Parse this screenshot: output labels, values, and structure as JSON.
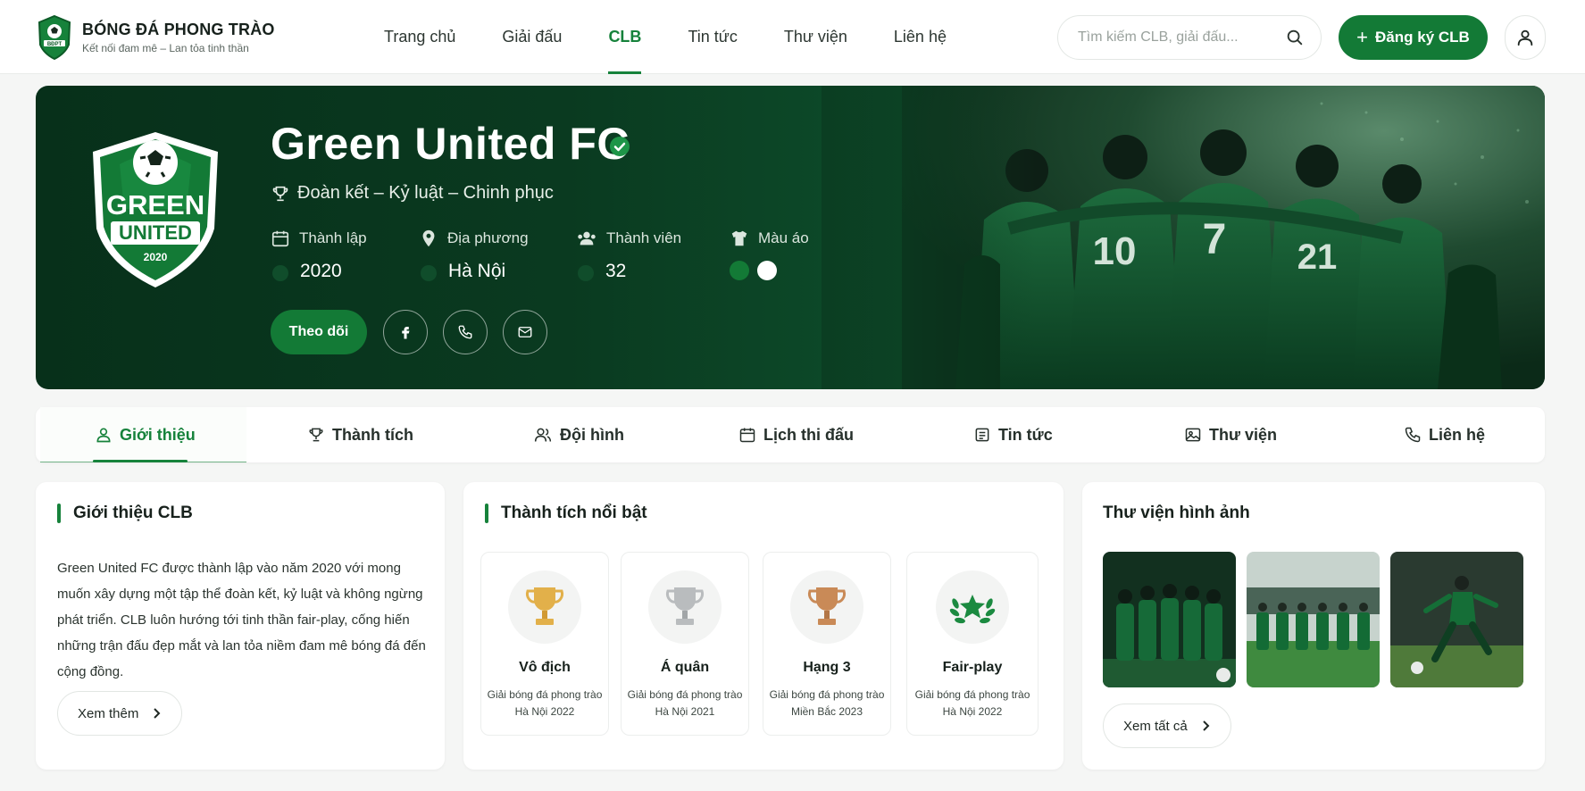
{
  "brand": {
    "title": "BÓNG ĐÁ PHONG TRÀO",
    "subtitle": "Kết nối đam mê – Lan tỏa tinh thần",
    "logo_text": "BĐPT"
  },
  "nav": {
    "items": [
      "Trang chủ",
      "Giải đấu",
      "CLB",
      "Tin tức",
      "Thư viện",
      "Liên hệ"
    ],
    "active": "CLB"
  },
  "search": {
    "placeholder": "Tìm kiếm CLB, giải đấu..."
  },
  "register_button": "Đăng ký CLB",
  "club": {
    "name": "Green United FC",
    "slogan": "Đoàn kết – Kỷ luật – Chinh phục",
    "crest_line1": "GREEN",
    "crest_line2": "UNITED",
    "crest_year": "2020",
    "stats": {
      "founded_label": "Thành lập",
      "founded_value": "2020",
      "location_label": "Địa phương",
      "location_value": "Hà Nội",
      "members_label": "Thành viên",
      "members_value": "32",
      "kit_label": "Màu áo",
      "kit_colors": [
        "#137a36",
        "#ffffff"
      ]
    },
    "follow_button": "Theo dõi"
  },
  "tabs": {
    "items": [
      "Giới thiệu",
      "Thành tích",
      "Đội hình",
      "Lịch thi đấu",
      "Tin tức",
      "Thư viện",
      "Liên hệ"
    ],
    "active": "Giới thiệu"
  },
  "about": {
    "title": "Giới thiệu CLB",
    "text": "Green United FC được thành lập vào năm 2020 với mong muốn xây dựng một tập thể đoàn kết, kỷ luật và không ngừng phát triển. CLB luôn hướng tới tinh thần fair-play, cống hiến những trận đấu đẹp mắt và lan tỏa niềm đam mê bóng đá đến cộng đồng.",
    "more_button": "Xem thêm"
  },
  "achievements": {
    "title": "Thành tích nổi bật",
    "items": [
      {
        "title": "Vô địch",
        "line1": "Giải bóng đá phong trào",
        "line2": "Hà Nội 2022",
        "icon": "gold-trophy-icon"
      },
      {
        "title": "Á quân",
        "line1": "Giải bóng đá phong trào",
        "line2": "Hà Nội 2021",
        "icon": "silver-trophy-icon"
      },
      {
        "title": "Hạng 3",
        "line1": "Giải bóng đá phong trào",
        "line2": "Miền Bắc 2023",
        "icon": "bronze-trophy-icon"
      },
      {
        "title": "Fair-play",
        "line1": "Giải bóng đá phong trào",
        "line2": "Hà Nội 2022",
        "icon": "laurel-star-icon"
      }
    ]
  },
  "gallery": {
    "title": "Thư viện hình ảnh",
    "view_all_button": "Xem tất cả",
    "jersey_numbers": [
      "10",
      "7",
      "21"
    ]
  },
  "colors": {
    "accent": "#137a36",
    "hero_dark": "#07301a",
    "gold": "#e2b04a",
    "silver": "#b9bcbe",
    "bronze": "#c98a57"
  }
}
